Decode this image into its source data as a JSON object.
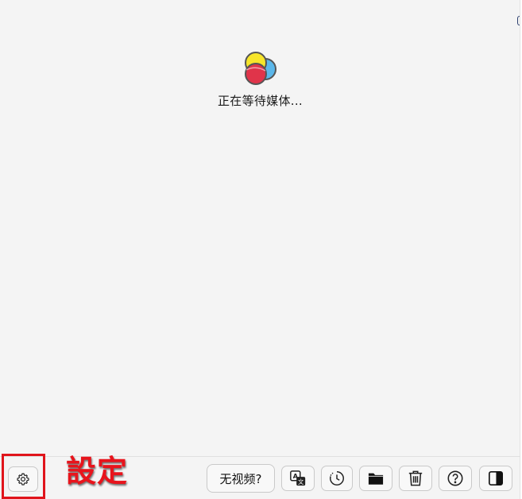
{
  "status": {
    "waiting_text": "正在等待媒体..."
  },
  "annotation": {
    "label": "設定",
    "color": "#e8141c"
  },
  "footer": {
    "settings_icon": "gear-icon",
    "no_video_label": "无视频?",
    "buttons": [
      {
        "name": "translate-button",
        "icon": "translate-icon"
      },
      {
        "name": "history-button",
        "icon": "clock-icon"
      },
      {
        "name": "folder-button",
        "icon": "folder-icon"
      },
      {
        "name": "trash-button",
        "icon": "trash-icon"
      },
      {
        "name": "help-button",
        "icon": "question-icon"
      },
      {
        "name": "toggle-panel-button",
        "icon": "sidebar-panel-icon"
      }
    ]
  },
  "colors": {
    "background": "#f4f4f4",
    "logo_yellow": "#f7e52a",
    "logo_blue": "#5bb7ea",
    "logo_red": "#e0344a"
  }
}
